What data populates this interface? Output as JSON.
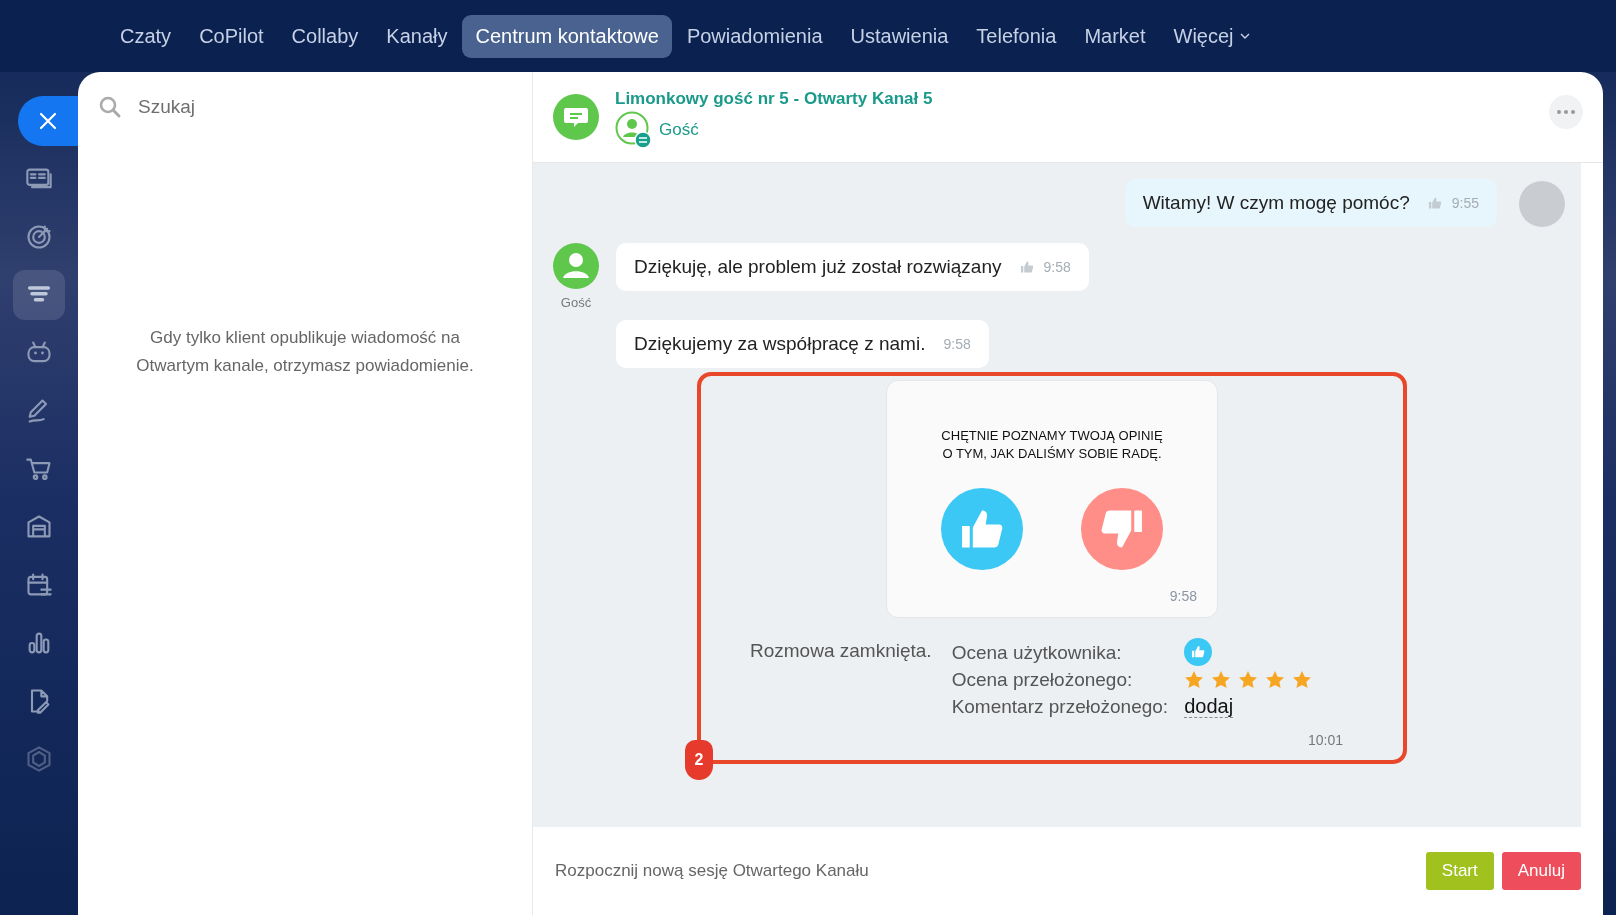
{
  "top_nav": {
    "items": [
      {
        "label": "Czaty",
        "selected": false,
        "dropdown": false
      },
      {
        "label": "CoPilot",
        "selected": false,
        "dropdown": false
      },
      {
        "label": "Collaby",
        "selected": false,
        "dropdown": false
      },
      {
        "label": "Kanały",
        "selected": false,
        "dropdown": false
      },
      {
        "label": "Centrum kontaktowe",
        "selected": true,
        "dropdown": false
      },
      {
        "label": "Powiadomienia",
        "selected": false,
        "dropdown": false
      },
      {
        "label": "Ustawienia",
        "selected": false,
        "dropdown": false
      },
      {
        "label": "Telefonia",
        "selected": false,
        "dropdown": false
      },
      {
        "label": "Market",
        "selected": false,
        "dropdown": false
      },
      {
        "label": "Więcej",
        "selected": false,
        "dropdown": true
      }
    ]
  },
  "sidebar": {
    "items": [
      {
        "selected": false
      },
      {
        "selected": false
      },
      {
        "selected": false
      },
      {
        "selected": true
      },
      {
        "selected": false
      },
      {
        "selected": false
      },
      {
        "selected": false
      },
      {
        "selected": false
      },
      {
        "selected": false
      },
      {
        "selected": false
      },
      {
        "selected": false
      },
      {
        "selected": false
      }
    ]
  },
  "left_panel": {
    "search": {
      "placeholder": "Szukaj"
    },
    "empty_message": "Gdy tylko klient opublikuje wiadomość na Otwartym kanale, otrzymasz powiadomienie."
  },
  "chat": {
    "title": "Limonkowy gość nr 5 - Otwarty Kanał 5",
    "subtitle": "Gość",
    "messages": [
      {
        "kind": "outgoing",
        "text": "Witamy! W czym mogę pomóc?",
        "time": "9:55",
        "like": true
      },
      {
        "kind": "incoming",
        "author": "Gość",
        "text": "Dziękuję, ale problem już został rozwiązany",
        "time": "9:58",
        "like": true
      },
      {
        "kind": "incoming",
        "text": "Dziękujemy za współpracę z nami.",
        "time": "9:58",
        "like": false
      }
    ],
    "highlight": {
      "badge": "2",
      "rating_card": {
        "lines": [
          "CHĘTNIE POZNAMY TWOJĄ OPINIĘ",
          "O TYM, JAK DALIŚMY SOBIE RADĘ."
        ],
        "time": "9:58"
      },
      "summary": {
        "status": "Rozmowa zamknięta.",
        "user_rating_label": "Ocena użytkownika:",
        "user_rating_like": true,
        "supervisor_rating_label": "Ocena przełożonego:",
        "stars": 5,
        "comment_label": "Komentarz przełożonego:",
        "comment_link": "dodaj",
        "time": "10:01"
      }
    }
  },
  "composer": {
    "text": "Rozpocznij nową sesję Otwartego Kanału",
    "buttons": [
      {
        "label": "Start",
        "kind": "primary"
      },
      {
        "label": "Anuluj",
        "kind": "danger"
      }
    ]
  }
}
